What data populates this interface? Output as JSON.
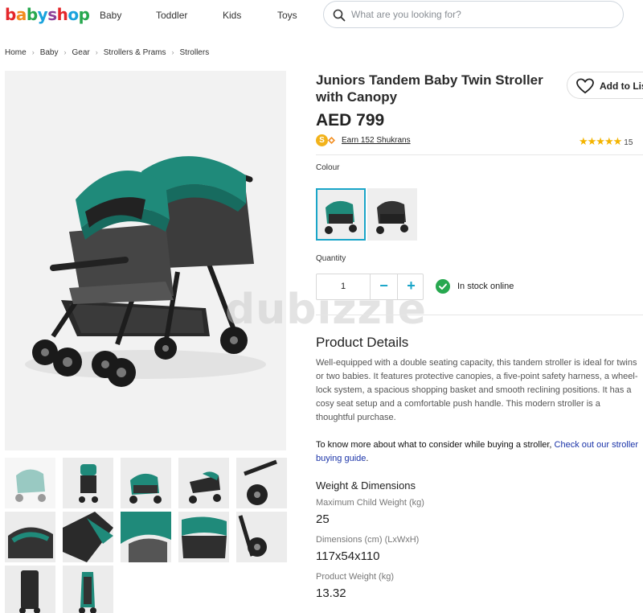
{
  "brand": {
    "logo_text": "babyshop",
    "logo_colors": [
      "#e4262a",
      "#f28c1d",
      "#27a84f",
      "#1aa3dd",
      "#8d3f98",
      "#e4262a",
      "#1aa3dd",
      "#27a84f"
    ]
  },
  "nav": {
    "items": [
      {
        "label": "Baby"
      },
      {
        "label": "Toddler"
      },
      {
        "label": "Kids"
      },
      {
        "label": "Toys"
      }
    ]
  },
  "search": {
    "placeholder": "What are you looking for?",
    "icon": "search-icon"
  },
  "breadcrumb": [
    "Home",
    "Baby",
    "Gear",
    "Strollers & Prams",
    "Strollers"
  ],
  "product": {
    "title": "Juniors Tandem Baby Twin Stroller with Canopy",
    "add_to_list_label": "Add to List",
    "price": "AED 799",
    "shukrans_label": "Earn 152 Shukrans",
    "shukrans_coin": "S",
    "rating_stars": "★★★★★",
    "rating_value": 5,
    "rating_count": "15",
    "colour_label": "Colour",
    "quantity_label": "Quantity",
    "quantity_value": "1",
    "qty_minus": "−",
    "qty_plus": "+",
    "stock_text": "In stock online",
    "watermark": "dubizzle"
  },
  "details": {
    "heading": "Product Details",
    "description": "Well-equipped with a double seating capacity, this tandem stroller is ideal for twins or two babies. It features protective canopies, a five-point safety harness, a wheel-lock system, a spacious shopping basket and smooth reclining positions. It has a cosy seat setup and a comfortable push handle. This modern stroller is a thoughtful purchase.",
    "guide_text": "To know more about what to consider while buying a stroller, ",
    "guide_link": "Check out our stroller buying guide",
    "guide_end": "."
  },
  "dimensions": {
    "heading": "Weight & Dimensions",
    "specs": [
      {
        "label": "Maximum Child Weight (kg)",
        "value": "25"
      },
      {
        "label": "Dimensions (cm) (LxWxH)",
        "value": "117x54x110"
      },
      {
        "label": "Product Weight (kg)",
        "value": "13.32"
      }
    ]
  },
  "colors": {
    "accent": "#19a5c8",
    "stroller_green": "#1f8a7a",
    "link": "#1a33a8",
    "star": "#f4b400",
    "in_stock": "#27a84f"
  }
}
